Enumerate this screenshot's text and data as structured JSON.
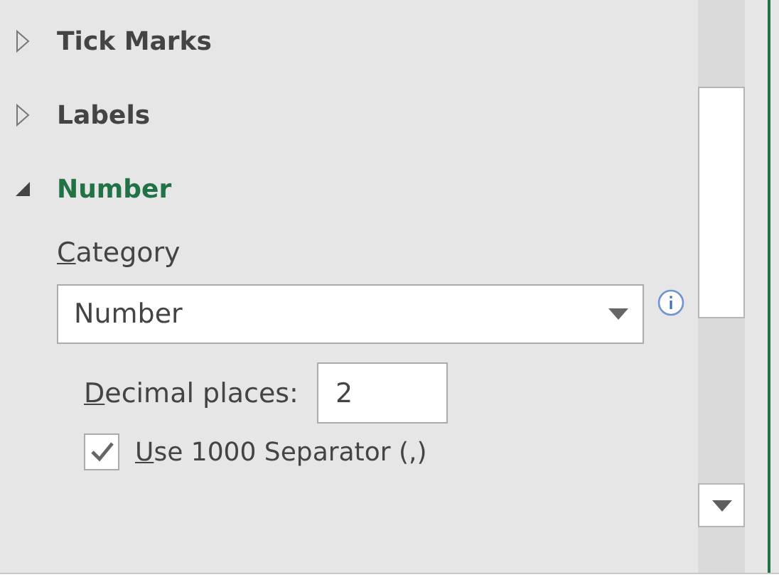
{
  "sections": [
    {
      "title": "Tick Marks",
      "expanded": false
    },
    {
      "title": "Labels",
      "expanded": false
    },
    {
      "title": "Number",
      "expanded": true
    }
  ],
  "number_options": {
    "category_label": {
      "text": "Category",
      "first_letter_underlined": true
    },
    "category": {
      "value": "Number"
    },
    "decimal_places": {
      "label": "Decimal places:",
      "first_letter_underlined": true,
      "value": "2"
    },
    "separator": {
      "label": "Use 1000 Separator (,)",
      "first_letter_underlined": true,
      "checked": true
    }
  }
}
